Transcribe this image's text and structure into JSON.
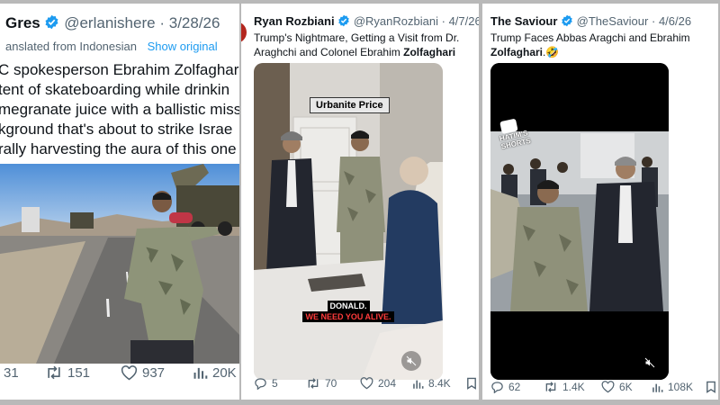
{
  "posts": [
    {
      "author": "Gres",
      "handle": "@erlanishere",
      "date": "3/28/26",
      "translated_label": "anslated from Indonesian",
      "show_original": "Show original",
      "lines": [
        "C spokesperson Ebrahim Zolfaghar",
        "tent of skateboarding while drinkin",
        "megranate juice with a ballistic miss",
        "kground that's about to strike Israe",
        "rally harvesting the aura of this one"
      ],
      "replies": "31",
      "reposts": "151",
      "likes": "937",
      "views": "20K"
    },
    {
      "author": "Ryan Rozbiani",
      "handle": "@RyanRozbiani",
      "date": "4/7/26",
      "text_line1": "Trump's Nightmare, Getting a Visit from Dr.",
      "text_line2_pre": "Araghchi and Colonel Ebrahim ",
      "text_line2_bold": "Zolfaghari",
      "sign_text": "Urbanite Price",
      "subtitle_line1": "DONALD.",
      "subtitle_line2": "WE NEED YOU ALIVE.",
      "replies": "5",
      "reposts": "70",
      "likes": "204",
      "views": "8.4K"
    },
    {
      "author": "The Saviour",
      "handle": "@TheSaviour",
      "date": "4/6/26",
      "text_line1": "Trump Faces Abbas Aragchi and Ebrahim",
      "text_line2_bold": "Zolfaghari",
      "text_line2_post": ".🤣",
      "watermark": "HATIM'S SHORTS",
      "replies": "62",
      "reposts": "1.4K",
      "likes": "6K",
      "views": "108K"
    }
  ],
  "colors": {
    "verified": "#1d9bf0",
    "link": "#1d9bf0",
    "text": "#0f1419",
    "muted": "#536471",
    "gutter": "#b9b9b9"
  }
}
